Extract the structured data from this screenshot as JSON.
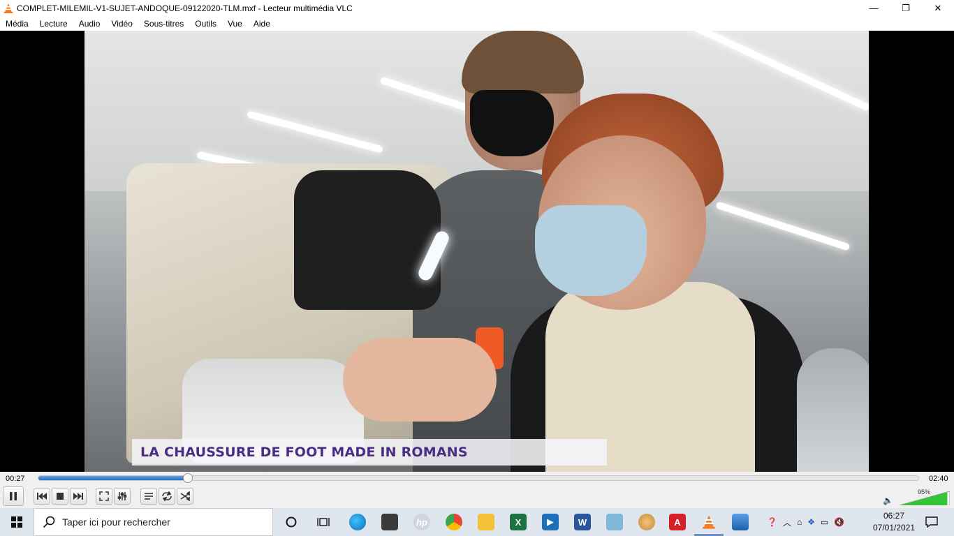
{
  "window": {
    "title": "COMPLET-MILEMIL-V1-SUJET-ANDOQUE-09122020-TLM.mxf - Lecteur multimédia VLC",
    "app_icon": "vlc-cone-icon",
    "minimize": "—",
    "maximize": "❐",
    "close": "✕"
  },
  "menu": {
    "items": [
      "Média",
      "Lecture",
      "Audio",
      "Vidéo",
      "Sous-titres",
      "Outils",
      "Vue",
      "Aide"
    ]
  },
  "video": {
    "caption": "LA CHAUSSURE DE FOOT MADE IN ROMANS"
  },
  "playback": {
    "elapsed": "00:27",
    "duration": "02:40",
    "progress_fraction": 0.17,
    "volume_percent_label": "95%",
    "volume_fraction": 0.95,
    "accent": "#2a6ebd"
  },
  "controls": {
    "play_pause_icon": "pause-icon",
    "prev_icon": "previous-icon",
    "stop_icon": "stop-icon",
    "next_icon": "next-icon",
    "fullscreen_icon": "fullscreen-icon",
    "extended_icon": "extended-settings-icon",
    "playlist_icon": "playlist-icon",
    "loop_icon": "loop-icon",
    "shuffle_icon": "shuffle-icon"
  },
  "taskbar": {
    "search_placeholder": "Taper ici pour rechercher",
    "clock_time": "06:27",
    "clock_date": "07/01/2021"
  }
}
